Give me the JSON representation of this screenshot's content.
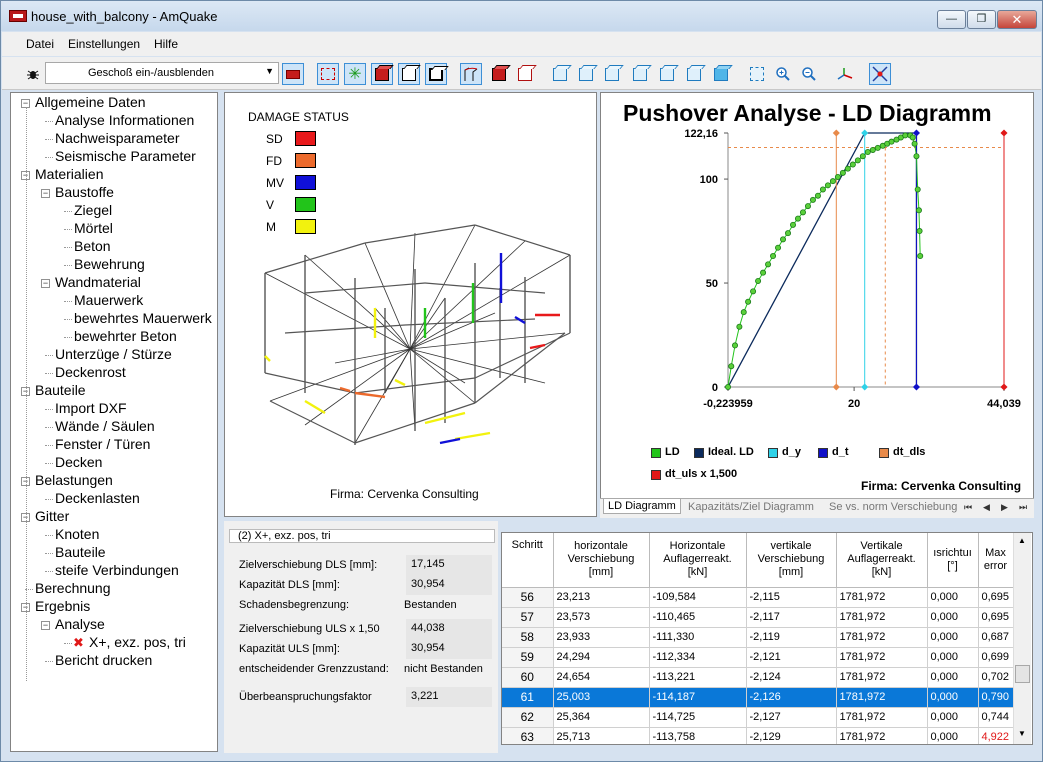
{
  "window": {
    "title": "house_with_balcony - AmQuake",
    "min": "—",
    "max": "❐",
    "close": "✕"
  },
  "menu": [
    "Datei",
    "Einstellungen",
    "Hilfe"
  ],
  "toolbar": {
    "geschoss_label": "Geschoß ein-/ausblenden"
  },
  "tree": [
    {
      "label": "Allgemeine Daten",
      "level": 0,
      "box": "−"
    },
    {
      "label": "Analyse Informationen",
      "level": 1
    },
    {
      "label": "Nachweisparameter",
      "level": 1
    },
    {
      "label": "Seismische Parameter",
      "level": 1
    },
    {
      "label": "Materialien",
      "level": 0,
      "box": "−"
    },
    {
      "label": "Baustoffe",
      "level": 1,
      "box": "−"
    },
    {
      "label": "Ziegel",
      "level": 2
    },
    {
      "label": "Mörtel",
      "level": 2
    },
    {
      "label": "Beton",
      "level": 2
    },
    {
      "label": "Bewehrung",
      "level": 2
    },
    {
      "label": "Wandmaterial",
      "level": 1,
      "box": "−"
    },
    {
      "label": "Mauerwerk",
      "level": 2
    },
    {
      "label": "bewehrtes Mauerwerk",
      "level": 2
    },
    {
      "label": "bewehrter Beton",
      "level": 2
    },
    {
      "label": "Unterzüge / Stürze",
      "level": 1
    },
    {
      "label": "Deckenrost",
      "level": 1
    },
    {
      "label": "Bauteile",
      "level": 0,
      "box": "−"
    },
    {
      "label": "Import DXF",
      "level": 1
    },
    {
      "label": "Wände / Säulen",
      "level": 1
    },
    {
      "label": "Fenster / Türen",
      "level": 1
    },
    {
      "label": "Decken",
      "level": 1
    },
    {
      "label": "Belastungen",
      "level": 0,
      "box": "−"
    },
    {
      "label": "Deckenlasten",
      "level": 1
    },
    {
      "label": "Gitter",
      "level": 0,
      "box": "−"
    },
    {
      "label": "Knoten",
      "level": 1
    },
    {
      "label": "Bauteile",
      "level": 1
    },
    {
      "label": "steife Verbindungen",
      "level": 1
    },
    {
      "label": "Berechnung",
      "level": 0
    },
    {
      "label": "Ergebnis",
      "level": 0,
      "box": "−"
    },
    {
      "label": "Analyse",
      "level": 1,
      "box": "−"
    },
    {
      "label": "X+, exz. pos, tri",
      "level": 2,
      "mark": "✖"
    },
    {
      "label": "Bericht drucken",
      "level": 1
    }
  ],
  "damage": {
    "title": "DAMAGE STATUS",
    "items": [
      {
        "label": "SD",
        "color": "#e8191b"
      },
      {
        "label": "FD",
        "color": "#ec6a2c"
      },
      {
        "label": "MV",
        "color": "#1010d8"
      },
      {
        "label": "V",
        "color": "#22c41a"
      },
      {
        "label": "M",
        "color": "#f2f20e"
      }
    ],
    "firma": "Firma: Cervenka Consulting"
  },
  "chart_data": {
    "type": "line",
    "title": "Pushover Analyse - LD Diagramm",
    "xlim": [
      -0.223959,
      44.039
    ],
    "ylim": [
      0,
      122.16
    ],
    "x_ticks": [
      "-0,223959",
      "20",
      "44,039"
    ],
    "y_ticks": [
      "0",
      "50",
      "100",
      "122,16"
    ],
    "series": [
      {
        "name": "LD",
        "color": "#22c41a",
        "x": [
          -0.22,
          0.3,
          0.9,
          1.6,
          2.3,
          3.0,
          3.8,
          4.6,
          5.4,
          6.2,
          7.0,
          7.8,
          8.6,
          9.4,
          10.2,
          11.0,
          11.8,
          12.6,
          13.4,
          14.2,
          15.0,
          15.8,
          16.6,
          17.4,
          18.2,
          19.0,
          19.8,
          20.6,
          21.4,
          22.2,
          23.0,
          23.8,
          24.6,
          25.3,
          26.0,
          26.8,
          27.5,
          28.2,
          29.0,
          29.4,
          29.7,
          30.0,
          30.2,
          30.4,
          30.5,
          30.6
        ],
        "y": [
          0,
          10,
          20,
          29,
          36,
          41,
          46,
          51,
          55,
          59,
          63,
          67,
          71,
          74,
          78,
          81,
          84,
          87,
          90,
          92,
          95,
          97,
          99,
          101,
          103,
          105,
          107,
          109,
          111,
          113,
          114,
          115,
          116,
          117,
          118,
          119,
          120,
          121,
          121,
          120,
          117,
          111,
          95,
          85,
          75,
          63
        ]
      },
      {
        "name": "Ideal. LD",
        "color": "#0b2a5c",
        "x": [
          -0.22,
          21.7,
          30.0,
          30.0
        ],
        "y": [
          0,
          122.16,
          122.16,
          0
        ]
      },
      {
        "name": "d_y",
        "color": "#2fd2e8",
        "x": [
          21.7,
          21.7
        ],
        "y": [
          0,
          122.16
        ]
      },
      {
        "name": "d_t",
        "color": "#1010c8",
        "x": [
          30.0,
          30.0
        ],
        "y": [
          0,
          122.16
        ]
      },
      {
        "name": "dt_dls",
        "color": "#e88a4a",
        "x": [
          17.145,
          17.145
        ],
        "y": [
          0,
          122.16
        ]
      },
      {
        "name": "dt_uls x 1,500",
        "color": "#e01818",
        "x": [
          44.039,
          44.039
        ],
        "y": [
          0,
          122.16
        ]
      }
    ],
    "markers": {
      "hline_y": 115.2,
      "vline_x": 25.0
    },
    "firma": "Firma: Cervenka Consulting"
  },
  "tabs": [
    "LD Diagramm",
    "Kapazitäts/Ziel Diagramm",
    "Se vs. norm Verschiebung"
  ],
  "results": {
    "combo": "(2) X+, exz. pos, tri",
    "rows": [
      {
        "label": "Zielverschiebung DLS [mm]:",
        "value": "17,145"
      },
      {
        "label": "Kapazität DLS [mm]:",
        "value": "30,954"
      },
      {
        "label": "Schadensbegrenzung:",
        "value": "Bestanden"
      },
      {
        "label": "Zielverschiebung ULS x 1,50",
        "value": "44,038"
      },
      {
        "label": "Kapazität ULS [mm]:",
        "value": "30,954"
      },
      {
        "label": "entscheidender Grenzzustand:",
        "value": "nicht Bestanden"
      },
      {
        "label": "Überbeanspruchungsfaktor",
        "value": "3,221"
      }
    ]
  },
  "table": {
    "headers": [
      "Schritt",
      "horizontale\nVerschiebung\n[mm]",
      "Horizontale\nAuflagerreakt.\n[kN]",
      "vertikale\nVerschiebung\n[mm]",
      "Vertikale\nAuflagerreakt.\n[kN]",
      "ısrichtuı\n[°]",
      "Max\nerror"
    ],
    "rows": [
      [
        "56",
        "23,213",
        "-109,584",
        "-2,115",
        "1781,972",
        "0,000",
        "0,695"
      ],
      [
        "57",
        "23,573",
        "-110,465",
        "-2,117",
        "1781,972",
        "0,000",
        "0,695"
      ],
      [
        "58",
        "23,933",
        "-111,330",
        "-2,119",
        "1781,972",
        "0,000",
        "0,687"
      ],
      [
        "59",
        "24,294",
        "-112,334",
        "-2,121",
        "1781,972",
        "0,000",
        "0,699"
      ],
      [
        "60",
        "24,654",
        "-113,221",
        "-2,124",
        "1781,972",
        "0,000",
        "0,702"
      ],
      [
        "61",
        "25,003",
        "-114,187",
        "-2,126",
        "1781,972",
        "0,000",
        "0,790"
      ],
      [
        "62",
        "25,364",
        "-114,725",
        "-2,127",
        "1781,972",
        "0,000",
        "0,744"
      ],
      [
        "63",
        "25,713",
        "-113,758",
        "-2,129",
        "1781,972",
        "0,000",
        "4,922"
      ]
    ],
    "selected_row": "61",
    "error_color": "#e01818"
  }
}
